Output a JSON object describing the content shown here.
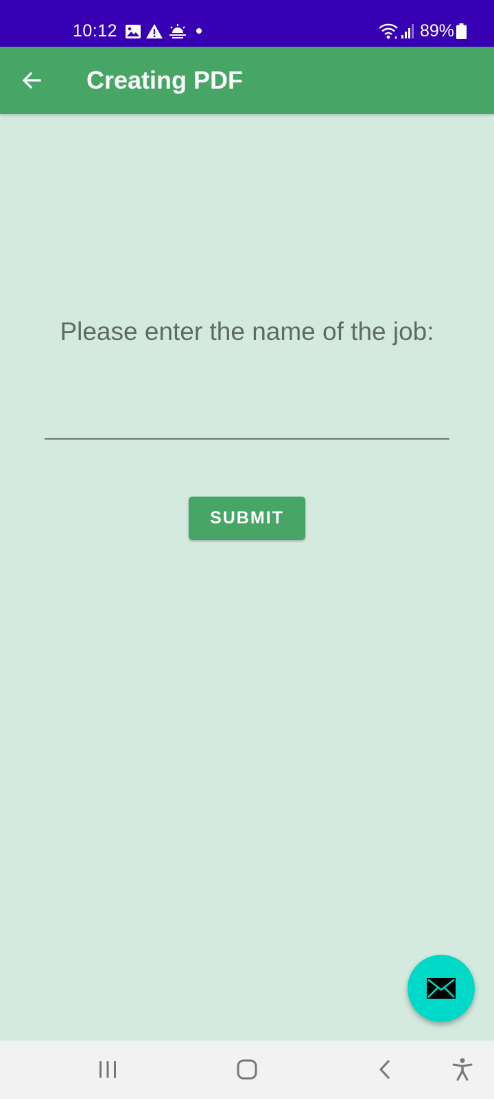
{
  "status_bar": {
    "time": "10:12",
    "battery_percent": "89%",
    "icons": [
      "image-icon",
      "warning-icon",
      "sunrise-icon",
      "dot-icon",
      "wifi-icon",
      "signal-icon",
      "battery-icon"
    ]
  },
  "app_bar": {
    "title": "Creating PDF",
    "back_icon": "arrow-back-icon"
  },
  "form": {
    "prompt": "Please enter the name of the job:",
    "job_name_value": "",
    "job_name_placeholder": "",
    "submit_label": "SUBMIT"
  },
  "fab": {
    "icon": "mail-icon"
  },
  "nav_bar": {
    "icons": [
      "recent-apps-icon",
      "home-icon",
      "back-icon",
      "accessibility-icon"
    ]
  },
  "colors": {
    "status_bar": "#3700b3",
    "app_bar": "#47a566",
    "background": "#d4eadf",
    "fab": "#00d9c7",
    "submit_button": "#47a566"
  }
}
